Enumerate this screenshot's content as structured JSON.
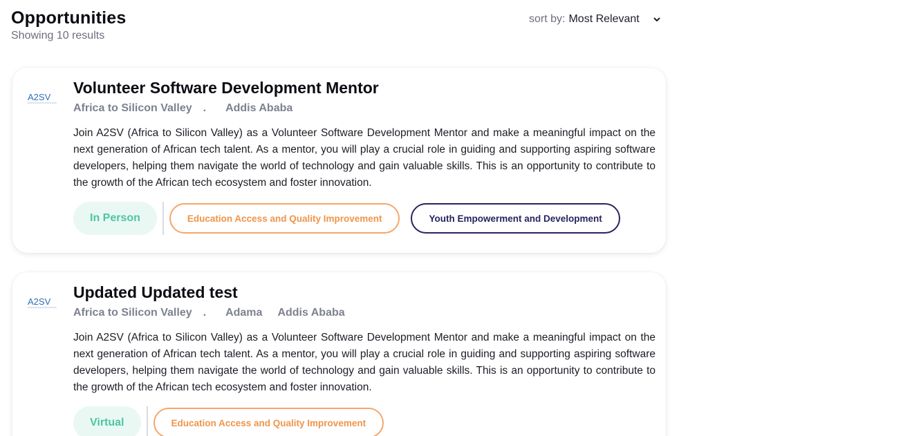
{
  "header": {
    "title": "Opportunities",
    "subtitle": "Showing 10 results",
    "sort_label": "sort by:",
    "sort_value": "Most Relevant"
  },
  "colors": {
    "mode_text": "#4fc4a3",
    "mode_bg": "#e9f8f3",
    "category_orange": "#ef9549",
    "category_navy": "#26245e",
    "meta_gray": "#7d8190"
  },
  "opportunities": [
    {
      "logo_text": "A2SV",
      "title": "Volunteer Software Development Mentor",
      "org": "Africa to Silicon Valley",
      "separator": ".",
      "locations": [
        "Addis Ababa"
      ],
      "description": "Join A2SV (Africa to Silicon Valley) as a Volunteer Software Development Mentor and make a meaningful impact on the next generation of African tech talent. As a mentor, you will play a crucial role in guiding and supporting aspiring software developers, helping them navigate the world of technology and gain valuable skills. This is an opportunity to contribute to the growth of the African tech ecosystem and foster innovation.",
      "mode": "In Person",
      "categories": [
        "Education Access and Quality Improvement",
        "Youth Empowerment and Development"
      ]
    },
    {
      "logo_text": "A2SV",
      "title": "Updated Updated test",
      "org": "Africa to Silicon Valley",
      "separator": ".",
      "locations": [
        "Adama",
        "Addis Ababa"
      ],
      "description": "Join A2SV (Africa to Silicon Valley) as a Volunteer Software Development Mentor and make a meaningful impact on the next generation of African tech talent. As a mentor, you will play a crucial role in guiding and supporting aspiring software developers, helping them navigate the world of technology and gain valuable skills. This is an opportunity to contribute to the growth of the African tech ecosystem and foster innovation.",
      "mode": "Virtual",
      "categories": [
        "Education Access and Quality Improvement"
      ]
    }
  ]
}
